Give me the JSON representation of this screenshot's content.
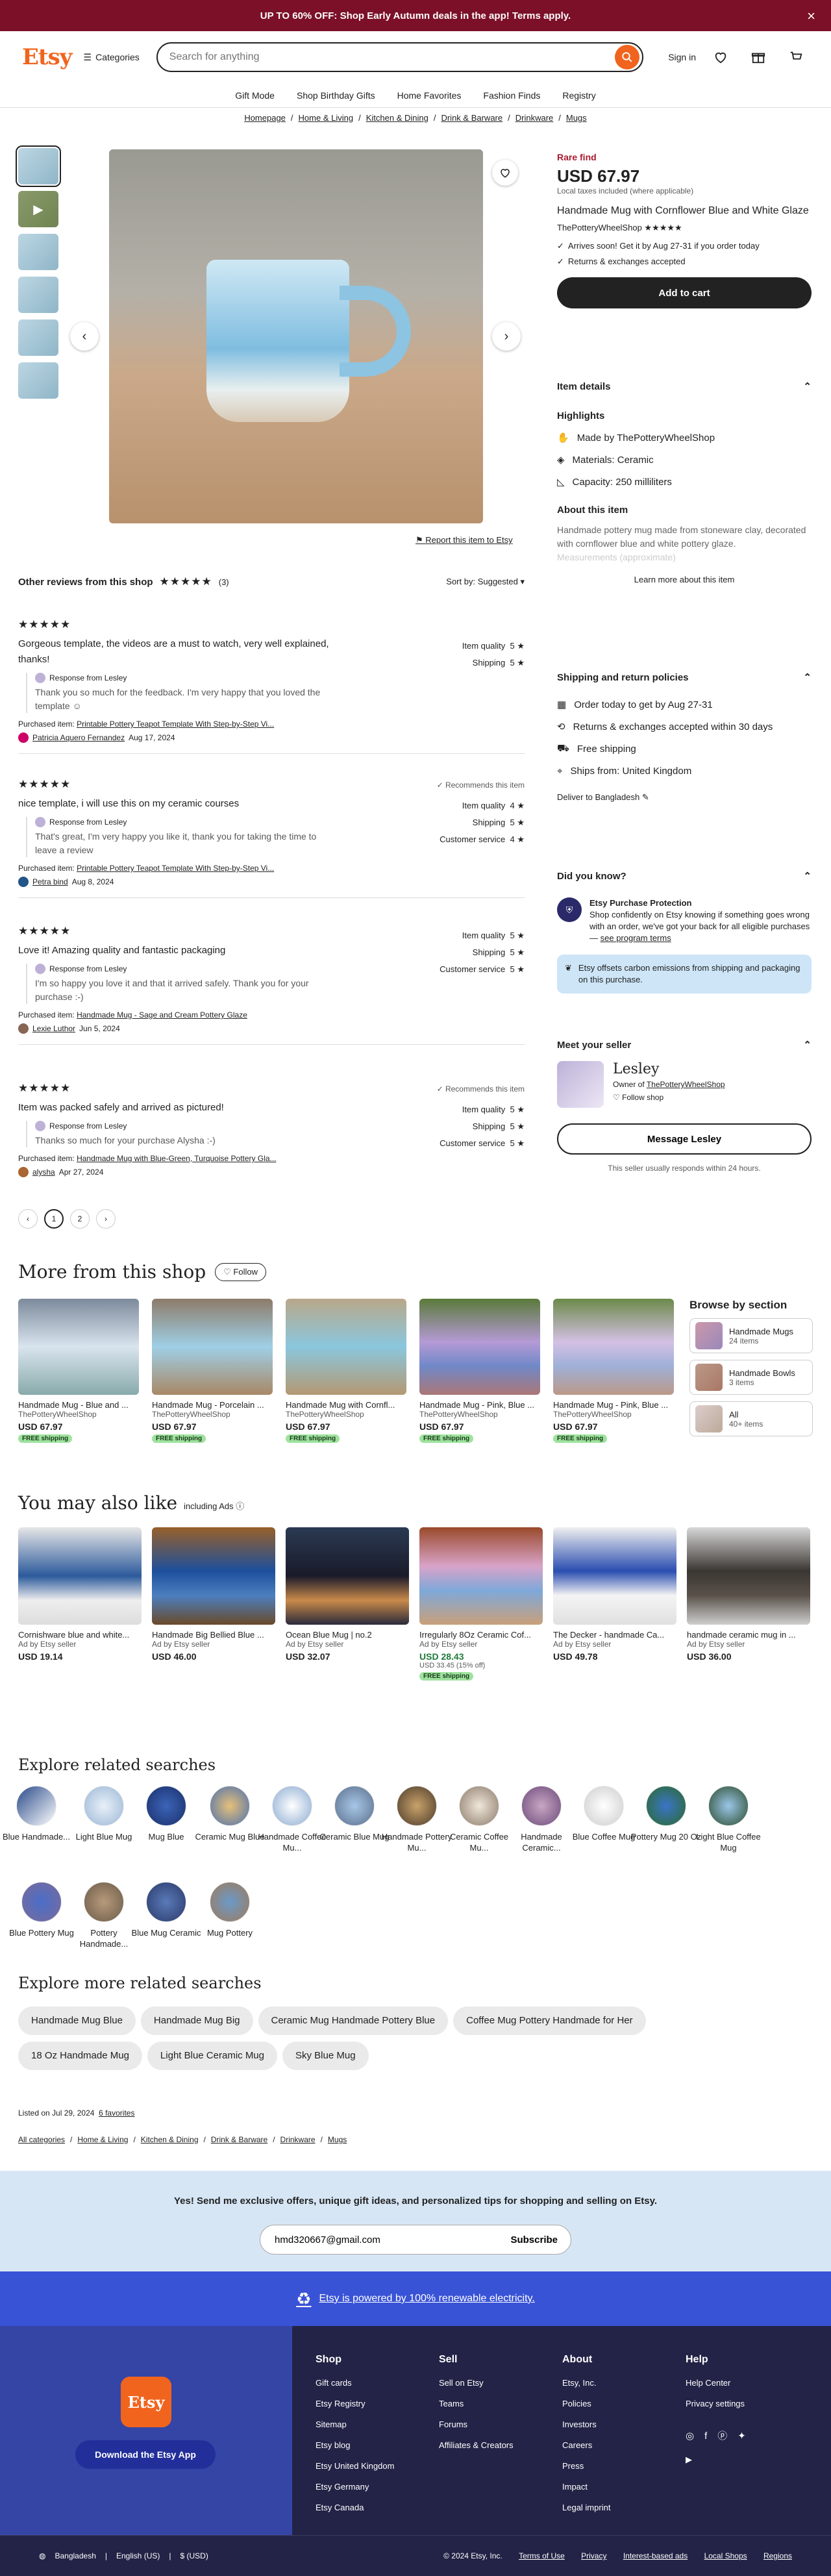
{
  "promo": "UP TO 60% OFF: Shop Early Autumn deals in the app! Terms apply.",
  "header": {
    "logo": "Etsy",
    "categories": "Categories",
    "search_placeholder": "Search for anything",
    "signin": "Sign in"
  },
  "subnav": [
    "Gift Mode",
    "Shop Birthday Gifts",
    "Home Favorites",
    "Fashion Finds",
    "Registry"
  ],
  "breadcrumbs": [
    "Homepage",
    "Home & Living",
    "Kitchen & Dining",
    "Drink & Barware",
    "Drinkware",
    "Mugs"
  ],
  "listing": {
    "badge": "Rare find",
    "price": "USD 67.97",
    "tax_note": "Local taxes included (where applicable)",
    "title": "Handmade Mug with Cornflower Blue and White Glaze",
    "shop": "ThePotteryWheelShop ★★★★★",
    "arrives": "Arrives soon! Get it by Aug 27-31 if you order today",
    "returns": "Returns & exchanges accepted",
    "add_to_cart": "Add to cart",
    "report": "Report this item to Etsy"
  },
  "details": {
    "heading": "Item details",
    "highlights_heading": "Highlights",
    "made_by": "Made by ThePotteryWheelShop",
    "materials": "Materials: Ceramic",
    "capacity": "Capacity: 250 milliliters",
    "about_heading": "About this item",
    "about_text": "Handmade pottery mug made from stoneware clay, decorated with cornflower blue and white pottery glaze.",
    "about_more": "Measurements (approximate)",
    "learn_more": "Learn more about this item"
  },
  "shipping": {
    "heading": "Shipping and return policies",
    "order_today": "Order today to get by Aug 27-31",
    "returns": "Returns & exchanges accepted within 30 days",
    "free": "Free shipping",
    "ships_from": "Ships from: United Kingdom",
    "deliver_to": "Deliver to Bangladesh"
  },
  "didyouknow": {
    "heading": "Did you know?",
    "protection_title": "Etsy Purchase Protection",
    "protection_text": "Shop confidently on Etsy knowing if something goes wrong with an order, we've got your back for all eligible purchases —",
    "protection_link": "see program terms",
    "carbon": "Etsy offsets carbon emissions from shipping and packaging on this purchase."
  },
  "seller": {
    "heading": "Meet your seller",
    "name": "Lesley",
    "owner_of": "Owner of",
    "shop": "ThePotteryWheelShop",
    "follow": "Follow shop",
    "message": "Message Lesley",
    "response": "This seller usually responds within 24 hours."
  },
  "reviews": {
    "heading": "Other reviews from this shop",
    "count": "(3)",
    "sort": "Sort by: Suggested",
    "items": [
      {
        "stars": "★★★★★",
        "text": "Gorgeous template, the videos are a must to watch, very well explained, thanks!",
        "response_label": "Response from Lesley",
        "response": "Thank you so much for the feedback. I'm very happy that you loved the template ☺",
        "purchased_label": "Purchased item:",
        "purchased": "Printable Pottery Teapot Template With Step-by-Step Vi...",
        "author": "Patricia Aquero Fernandez",
        "date": "Aug 17, 2024",
        "r1": "Item quality",
        "v1": "5 ★",
        "r2": "Shipping",
        "v2": "5 ★",
        "r3": "",
        "v3": "",
        "rec": ""
      },
      {
        "stars": "★★★★★",
        "text": "nice template, i will use this on my ceramic courses",
        "response_label": "Response from Lesley",
        "response": "That's great, I'm very happy you like it, thank you for taking the time to leave a review",
        "purchased_label": "Purchased item:",
        "purchased": "Printable Pottery Teapot Template With Step-by-Step Vi...",
        "author": "Petra bind",
        "date": "Aug 8, 2024",
        "r1": "Item quality",
        "v1": "4 ★",
        "r2": "Shipping",
        "v2": "5 ★",
        "r3": "Customer service",
        "v3": "4 ★",
        "rec": "✓ Recommends this item"
      },
      {
        "stars": "★★★★★",
        "text": "Love it! Amazing quality and fantastic packaging",
        "response_label": "Response from Lesley",
        "response": "I'm so happy you love it and that it arrived safely. Thank you for your purchase :-)",
        "purchased_label": "Purchased item:",
        "purchased": "Handmade Mug - Sage and Cream Pottery Glaze",
        "author": "Lexie Luthor",
        "date": "Jun 5, 2024",
        "r1": "Item quality",
        "v1": "5 ★",
        "r2": "Shipping",
        "v2": "5 ★",
        "r3": "Customer service",
        "v3": "5 ★",
        "rec": ""
      },
      {
        "stars": "★★★★★",
        "text": "Item was packed safely and arrived as pictured!",
        "response_label": "Response from Lesley",
        "response": "Thanks so much for your purchase Alysha :-)",
        "purchased_label": "Purchased item:",
        "purchased": "Handmade Mug with Blue-Green, Turquoise Pottery Gla...",
        "author": "alysha",
        "date": "Apr 27, 2024",
        "r1": "Item quality",
        "v1": "5 ★",
        "r2": "Shipping",
        "v2": "5 ★",
        "r3": "Customer service",
        "v3": "5 ★",
        "rec": "✓ Recommends this item"
      }
    ],
    "pages": [
      "‹",
      "1",
      "2",
      "›"
    ]
  },
  "more_shop": {
    "heading": "More from this shop",
    "follow": "Follow",
    "items": [
      {
        "name": "Handmade Mug - Blue and ...",
        "shop": "ThePotteryWheelShop",
        "price": "USD 67.97",
        "free": "FREE shipping"
      },
      {
        "name": "Handmade Mug - Porcelain ...",
        "shop": "ThePotteryWheelShop",
        "price": "USD 67.97",
        "free": "FREE shipping"
      },
      {
        "name": "Handmade Mug with Cornfl...",
        "shop": "ThePotteryWheelShop",
        "price": "USD 67.97",
        "free": "FREE shipping"
      },
      {
        "name": "Handmade Mug - Pink, Blue ...",
        "shop": "ThePotteryWheelShop",
        "price": "USD 67.97",
        "free": "FREE shipping"
      },
      {
        "name": "Handmade Mug - Pink, Blue ...",
        "shop": "ThePotteryWheelShop",
        "price": "USD 67.97",
        "free": "FREE shipping"
      }
    ],
    "browse_heading": "Browse by section",
    "sections": [
      {
        "name": "Handmade Mugs",
        "count": "24 items"
      },
      {
        "name": "Handmade Bowls",
        "count": "3 items"
      },
      {
        "name": "All",
        "count": "40+ items"
      }
    ]
  },
  "also_like": {
    "heading": "You may also like",
    "sub": "including Ads",
    "items": [
      {
        "name": "Cornishware blue and white...",
        "shop": "Ad by Etsy seller",
        "price": "USD 19.14",
        "old": "",
        "free": ""
      },
      {
        "name": "Handmade Big Bellied Blue ...",
        "shop": "Ad by Etsy seller",
        "price": "USD 46.00",
        "old": "",
        "free": ""
      },
      {
        "name": "Ocean Blue Mug | no.2",
        "shop": "Ad by Etsy seller",
        "price": "USD 32.07",
        "old": "",
        "free": ""
      },
      {
        "name": "Irregularly 8Oz Ceramic Cof...",
        "shop": "Ad by Etsy seller",
        "price": "USD 28.43",
        "old": "USD 33.45 (15% off)",
        "free": "FREE shipping"
      },
      {
        "name": "The Decker - handmade Ca...",
        "shop": "Ad by Etsy seller",
        "price": "USD 49.78",
        "old": "",
        "free": ""
      },
      {
        "name": "handmade ceramic mug in ...",
        "shop": "Ad by Etsy seller",
        "price": "USD 36.00",
        "old": "",
        "free": ""
      }
    ]
  },
  "related": {
    "heading": "Explore related searches",
    "items": [
      "Blue Handmade...",
      "Light Blue Mug",
      "Mug Blue",
      "Ceramic Mug Blue",
      "Handmade Coffee Mu...",
      "Ceramic Blue Mug",
      "Handmade Pottery Mu...",
      "Ceramic Coffee Mu...",
      "Handmade Ceramic...",
      "Blue Coffee Mug",
      "Pottery Mug 20 Oz",
      "Light Blue Coffee Mug",
      "Blue Pottery Mug",
      "Pottery Handmade...",
      "Blue Mug Ceramic",
      "Mug Pottery"
    ]
  },
  "more_related": {
    "heading": "Explore more related searches",
    "pills": [
      "Handmade Mug Blue",
      "Handmade Mug Big",
      "Ceramic Mug Handmade Pottery Blue",
      "Coffee Mug Pottery Handmade for Her",
      "18 Oz Handmade Mug",
      "Light Blue Ceramic Mug",
      "Sky Blue Mug"
    ]
  },
  "listed": {
    "text": "Listed on Jul 29, 2024",
    "favorites": "6 favorites"
  },
  "bottom_crumbs": [
    "All categories",
    "Home & Living",
    "Kitchen & Dining",
    "Drink & Barware",
    "Drinkware",
    "Mugs"
  ],
  "newsletter": {
    "text": "Yes! Send me exclusive offers, unique gift ideas, and personalized tips for shopping and selling on Etsy.",
    "email": "hmd320667@gmail.com",
    "button": "Subscribe"
  },
  "renewable": "Etsy is powered by 100% renewable electricity.",
  "footer": {
    "logo": "Etsy",
    "app_button": "Download the Etsy App",
    "cols": [
      {
        "title": "Shop",
        "links": [
          "Gift cards",
          "Etsy Registry",
          "Sitemap",
          "Etsy blog",
          "Etsy United Kingdom",
          "Etsy Germany",
          "Etsy Canada"
        ]
      },
      {
        "title": "Sell",
        "links": [
          "Sell on Etsy",
          "Teams",
          "Forums",
          "Affiliates & Creators"
        ]
      },
      {
        "title": "About",
        "links": [
          "Etsy, Inc.",
          "Policies",
          "Investors",
          "Careers",
          "Press",
          "Impact",
          "Legal imprint"
        ]
      },
      {
        "title": "Help",
        "links": [
          "Help Center",
          "Privacy settings"
        ]
      }
    ]
  },
  "bottombar": {
    "region": "Bangladesh",
    "lang": "English (US)",
    "currency": "$ (USD)",
    "copyright": "© 2024 Etsy, Inc.",
    "links": [
      "Terms of Use",
      "Privacy",
      "Interest-based ads",
      "Local Shops",
      "Regions"
    ]
  },
  "colors": {
    "brand": "#f1641e",
    "promo": "#7b1028",
    "renewable": "#3953d6",
    "footer": "#232347"
  }
}
